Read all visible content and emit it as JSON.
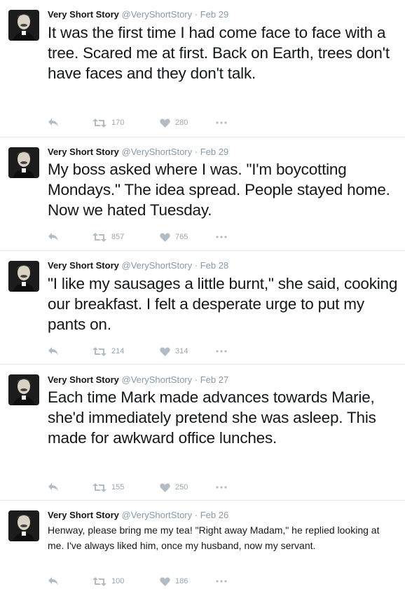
{
  "colors": {
    "name": "#14171a",
    "muted": "#8899a6",
    "action": "#b1bcc4",
    "divider": "#e1e8ed"
  },
  "tweets": [
    {
      "name": "Very Short Story",
      "handle": "@VeryShortStory",
      "separator": "·",
      "date": "Feb 29",
      "text": "It was the first time I had come face to face with a tree. Scared me at first. Back on Earth, trees don't have faces and they don't talk.",
      "retweets": "170",
      "likes": "280"
    },
    {
      "name": "Very Short Story",
      "handle": "@VeryShortStory",
      "separator": "·",
      "date": "Feb 29",
      "text": "My boss asked where I was. \"I'm boycotting Mondays.\" The idea spread. People stayed home. Now we hated Tuesday.",
      "retweets": "857",
      "likes": "765"
    },
    {
      "name": "Very Short Story",
      "handle": "@VeryShortStory",
      "separator": "·",
      "date": "Feb 28",
      "text": "\"I like my sausages a little burnt,\" she said, cooking our breakfast. I felt a desperate urge to put my pants on.",
      "retweets": "214",
      "likes": "314"
    },
    {
      "name": "Very Short Story",
      "handle": "@VeryShortStory",
      "separator": "·",
      "date": "Feb 27",
      "text": "Each time Mark made advances towards Marie, she'd immediately pretend she was asleep. This made for awkward office lunches.",
      "retweets": "155",
      "likes": "250"
    },
    {
      "name": "Very Short Story",
      "handle": "@VeryShortStory",
      "separator": "·",
      "date": "Feb 26",
      "text": "Henway, please bring me my tea! \"Right away Madam,\" he replied looking at me. I've always liked him, once my husband, now my servant.",
      "retweets": "100",
      "likes": "186"
    }
  ],
  "icons": {
    "reply": "reply-icon",
    "retweet": "retweet-icon",
    "like": "heart-icon",
    "more": "more-icon"
  }
}
